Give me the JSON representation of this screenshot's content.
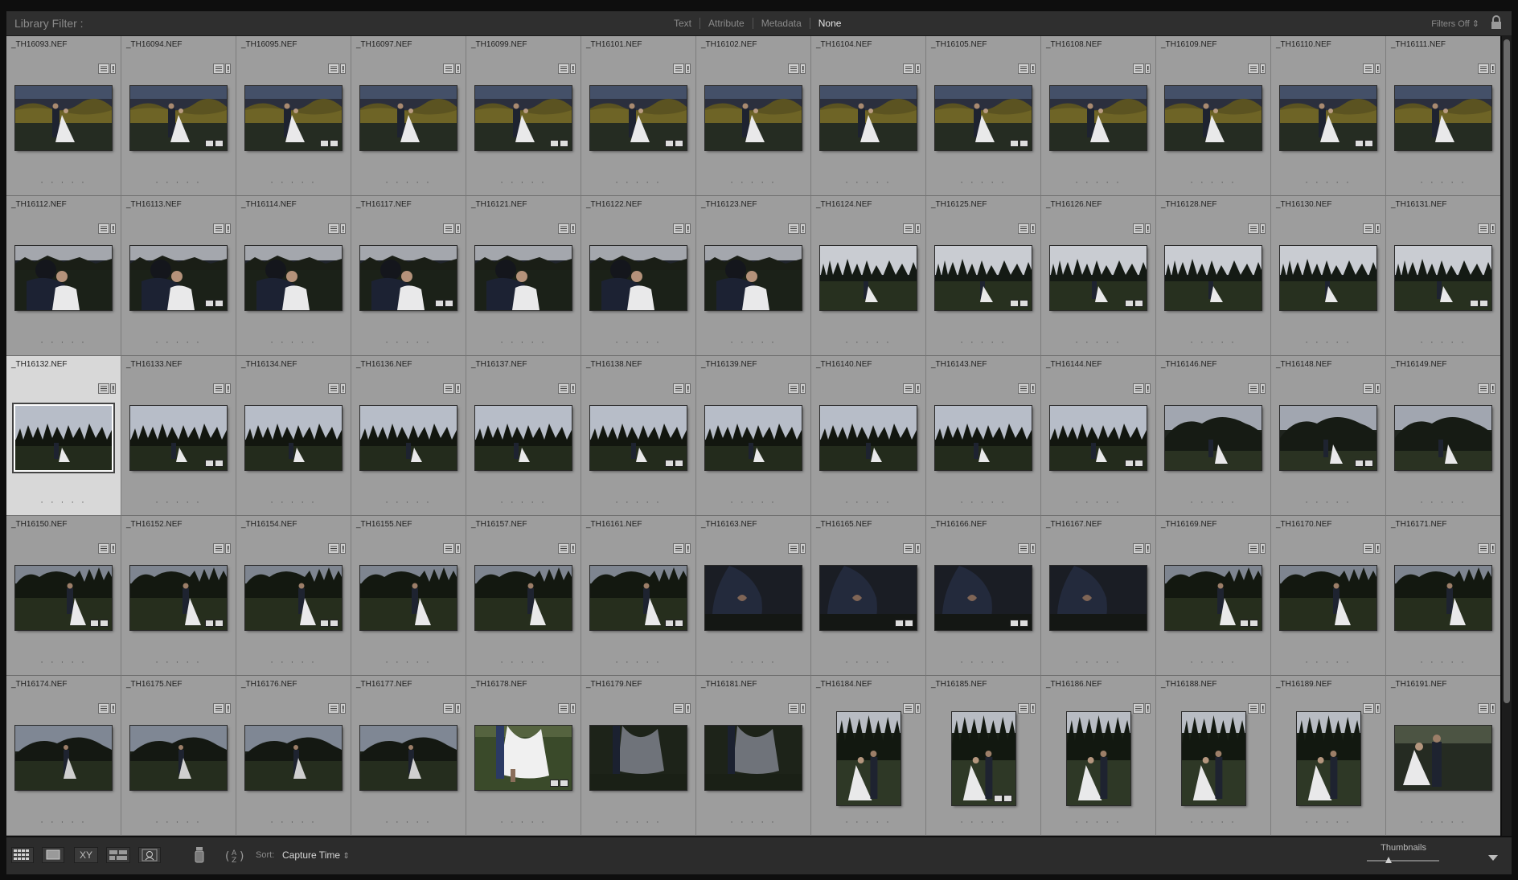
{
  "header": {
    "title": "Library Filter :",
    "tabs": [
      {
        "label": "Text",
        "active": false
      },
      {
        "label": "Attribute",
        "active": false
      },
      {
        "label": "Metadata",
        "active": false
      },
      {
        "label": "None",
        "active": true
      }
    ],
    "filters_preset": "Filters Off",
    "filters_preset_arrow": "⇕"
  },
  "grid": {
    "columns": 13,
    "selected_file": "_TH16132.NEF",
    "rating_dots": "· · · · ·",
    "rows": [
      [
        "_TH16093.NEF",
        "_TH16094.NEF",
        "_TH16095.NEF",
        "_TH16097.NEF",
        "_TH16099.NEF",
        "_TH16101.NEF",
        "_TH16102.NEF",
        "_TH16104.NEF",
        "_TH16105.NEF",
        "_TH16108.NEF",
        "_TH16109.NEF",
        "_TH16110.NEF",
        "_TH16111.NEF"
      ],
      [
        "_TH16112.NEF",
        "_TH16113.NEF",
        "_TH16114.NEF",
        "_TH16117.NEF",
        "_TH16121.NEF",
        "_TH16122.NEF",
        "_TH16123.NEF",
        "_TH16124.NEF",
        "_TH16125.NEF",
        "_TH16126.NEF",
        "_TH16128.NEF",
        "_TH16130.NEF",
        "_TH16131.NEF"
      ],
      [
        "_TH16132.NEF",
        "_TH16133.NEF",
        "_TH16134.NEF",
        "_TH16136.NEF",
        "_TH16137.NEF",
        "_TH16138.NEF",
        "_TH16139.NEF",
        "_TH16140.NEF",
        "_TH16143.NEF",
        "_TH16144.NEF",
        "_TH16146.NEF",
        "_TH16148.NEF",
        "_TH16149.NEF"
      ],
      [
        "_TH16150.NEF",
        "_TH16152.NEF",
        "_TH16154.NEF",
        "_TH16155.NEF",
        "_TH16157.NEF",
        "_TH16161.NEF",
        "_TH16163.NEF",
        "_TH16165.NEF",
        "_TH16166.NEF",
        "_TH16167.NEF",
        "_TH16169.NEF",
        "_TH16170.NEF",
        "_TH16171.NEF"
      ],
      [
        "_TH16174.NEF",
        "_TH16175.NEF",
        "_TH16176.NEF",
        "_TH16177.NEF",
        "_TH16178.NEF",
        "_TH16179.NEF",
        "_TH16181.NEF",
        "_TH16184.NEF",
        "_TH16185.NEF",
        "_TH16186.NEF",
        "_TH16188.NEF",
        "_TH16189.NEF",
        "_TH16191.NEF"
      ]
    ],
    "edited": [
      [
        false,
        true,
        true,
        false,
        true,
        true,
        false,
        false,
        true,
        false,
        false,
        true,
        false
      ],
      [
        false,
        true,
        false,
        true,
        false,
        false,
        false,
        false,
        true,
        true,
        false,
        false,
        true
      ],
      [
        false,
        true,
        false,
        false,
        false,
        true,
        false,
        false,
        false,
        true,
        false,
        true,
        false
      ],
      [
        true,
        true,
        true,
        false,
        false,
        true,
        false,
        true,
        true,
        false,
        true,
        false,
        false
      ],
      [
        false,
        false,
        false,
        false,
        true,
        false,
        false,
        false,
        true,
        false,
        false,
        false,
        false
      ]
    ],
    "portrait": [
      [
        false,
        false,
        false,
        false,
        false,
        false,
        false,
        false,
        false,
        false,
        false,
        false,
        false
      ],
      [
        false,
        false,
        false,
        false,
        false,
        false,
        false,
        false,
        false,
        false,
        false,
        false,
        false
      ],
      [
        false,
        false,
        false,
        false,
        false,
        false,
        false,
        false,
        false,
        false,
        false,
        false,
        false
      ],
      [
        false,
        false,
        false,
        false,
        false,
        false,
        false,
        false,
        false,
        false,
        false,
        false,
        false
      ],
      [
        false,
        false,
        false,
        false,
        false,
        false,
        false,
        true,
        true,
        true,
        true,
        true,
        false
      ]
    ],
    "row_scene": [
      "golden-field-couple",
      "sunset-closeup",
      "dusk-treeline",
      "dark-trees-couple",
      "mixed-final"
    ]
  },
  "toolbar": {
    "view_modes": [
      "grid-view-icon",
      "loupe-view-icon",
      "compare-view-icon",
      "survey-view-icon",
      "people-view-icon"
    ],
    "compare_label": "XY",
    "sort_label": "Sort:",
    "sort_value": "Capture Time",
    "sort_arrow": "⇕",
    "thumbnails_label": "Thumbnails",
    "thumbnail_size": 0.3
  },
  "colors": {
    "cell_bg": "#9d9d9d",
    "cell_selected_bg": "#d8d8d8",
    "panel_bg": "#2f2f2f"
  }
}
